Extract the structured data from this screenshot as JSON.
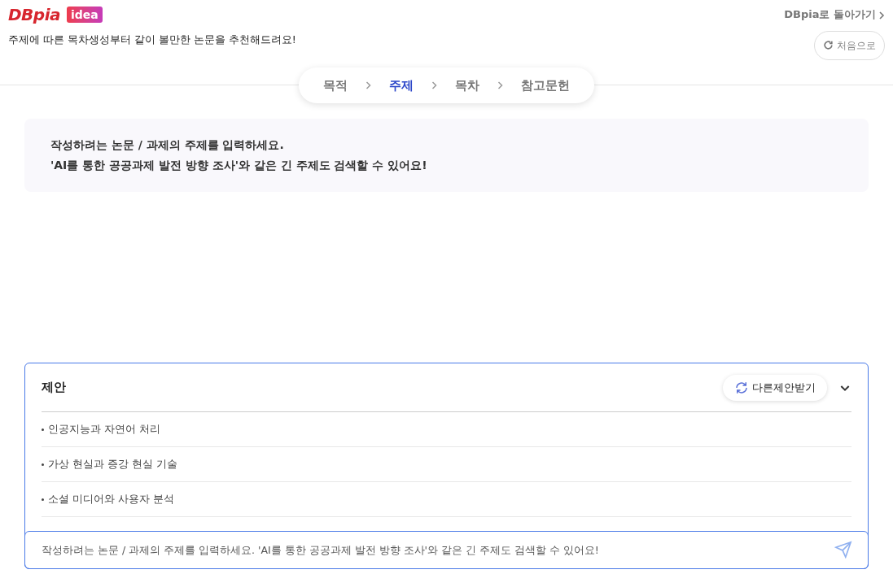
{
  "header": {
    "logo": "DBpia",
    "badge": "idea",
    "subtitle": "주제에 따른 목차생성부터 같이 볼만한 논문을 추천해드려요!",
    "back_link": "DBpia로 돌아가기",
    "reset_button": "처음으로"
  },
  "steps": [
    {
      "label": "목적",
      "selected": false
    },
    {
      "label": "주제",
      "selected": true
    },
    {
      "label": "목차",
      "selected": false
    },
    {
      "label": "참고문헌",
      "selected": false
    }
  ],
  "info": [
    "작성하려는 논문 / 과제의 주제를 입력하세요.",
    "'AI를 통한 공공과제 발전 방향 조사'와 같은 긴 주제도 검색할 수 있어요!"
  ],
  "suggestions": {
    "title": "제안",
    "refresh_button": "다른제안받기",
    "items": [
      "인공지능과 자연어 처리",
      "가상 현실과 증강 현실 기술",
      "소셜 미디어와 사용자 분석"
    ]
  },
  "input": {
    "placeholder": "작성하려는 논문 / 과제의 주제를 입력하세요. 'AI를 통한 공공과제 발전 방향 조사'와 같은 긴 주제도 검색할 수 있어요!"
  }
}
